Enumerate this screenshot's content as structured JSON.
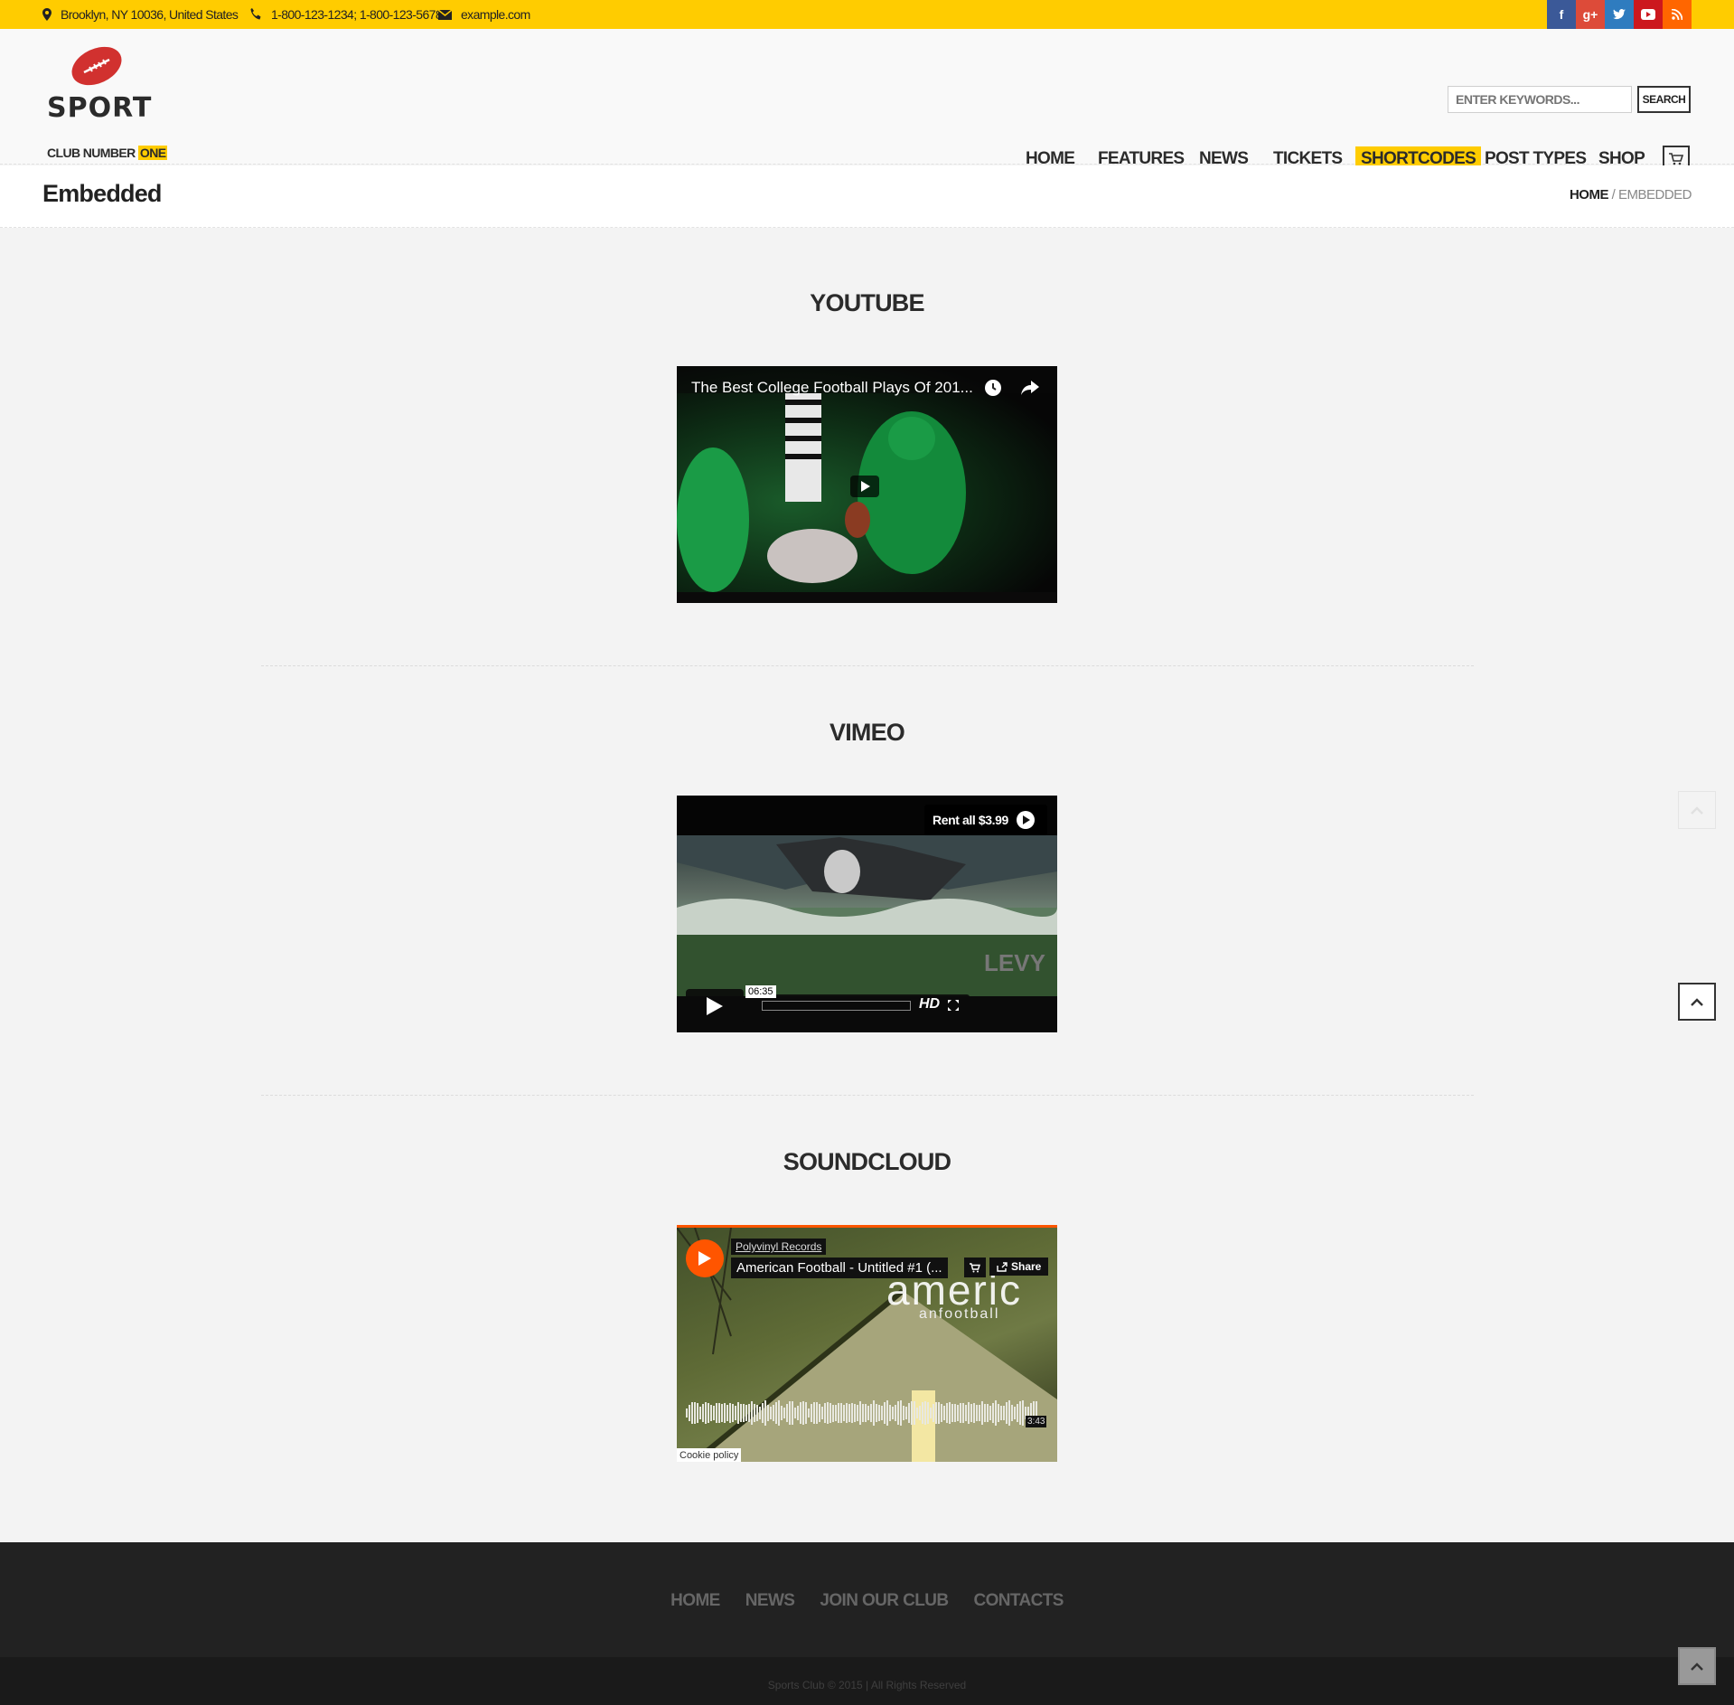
{
  "topbar": {
    "address": "Brooklyn, NY 10036, United States",
    "phone": "1-800-123-1234; 1-800-123-5678",
    "email": "example.com",
    "social": [
      {
        "icon": "facebook-icon",
        "glyph": "f",
        "color": "#3b5998"
      },
      {
        "icon": "google-plus-icon",
        "glyph": "g+",
        "color": "#dd4b39"
      },
      {
        "icon": "twitter-icon",
        "glyph": "t",
        "color": "#2f7cbf"
      },
      {
        "icon": "youtube-icon",
        "glyph": "▶",
        "color": "#cc181e"
      },
      {
        "icon": "rss-icon",
        "glyph": "rss",
        "color": "#ff6600"
      }
    ]
  },
  "header": {
    "logo_word": "SPORT",
    "logo_tag": "CLUB NUMBER",
    "logo_tag_hl": "ONE",
    "search_placeholder": "ENTER KEYWORDS...",
    "search_button": "SEARCH",
    "nav": [
      "HOME",
      "FEATURES",
      "NEWS",
      "TICKETS",
      "SHORTCODES",
      "POST TYPES",
      "SHOP"
    ],
    "active_nav": "SHORTCODES"
  },
  "page": {
    "title": "Embedded",
    "breadcrumb_home": "HOME",
    "breadcrumb_sep": " / ",
    "breadcrumb_current": "EMBEDDED"
  },
  "sections": {
    "youtube": {
      "heading": "YOUTUBE",
      "video_title": "The Best College Football Plays Of 201..."
    },
    "vimeo": {
      "heading": "VIMEO",
      "rent_label": "Rent all $3.99",
      "time": "06:35",
      "hd": "HD"
    },
    "soundcloud": {
      "heading": "SOUNDCLOUD",
      "user": "Polyvinyl Records",
      "track": "American Football - Untitled #1 (...",
      "share": "Share",
      "art_big": "americ",
      "art_small": "anfootball",
      "duration": "3:43",
      "cookie": "Cookie policy"
    }
  },
  "footer": {
    "nav": [
      "HOME",
      "NEWS",
      "JOIN OUR CLUB",
      "CONTACTS"
    ],
    "copyright": "Sports Club © 2015 | All Rights Reserved"
  },
  "colors": {
    "accent": "#ffcc00",
    "soundcloud": "#ff5500",
    "footer": "#222222"
  }
}
